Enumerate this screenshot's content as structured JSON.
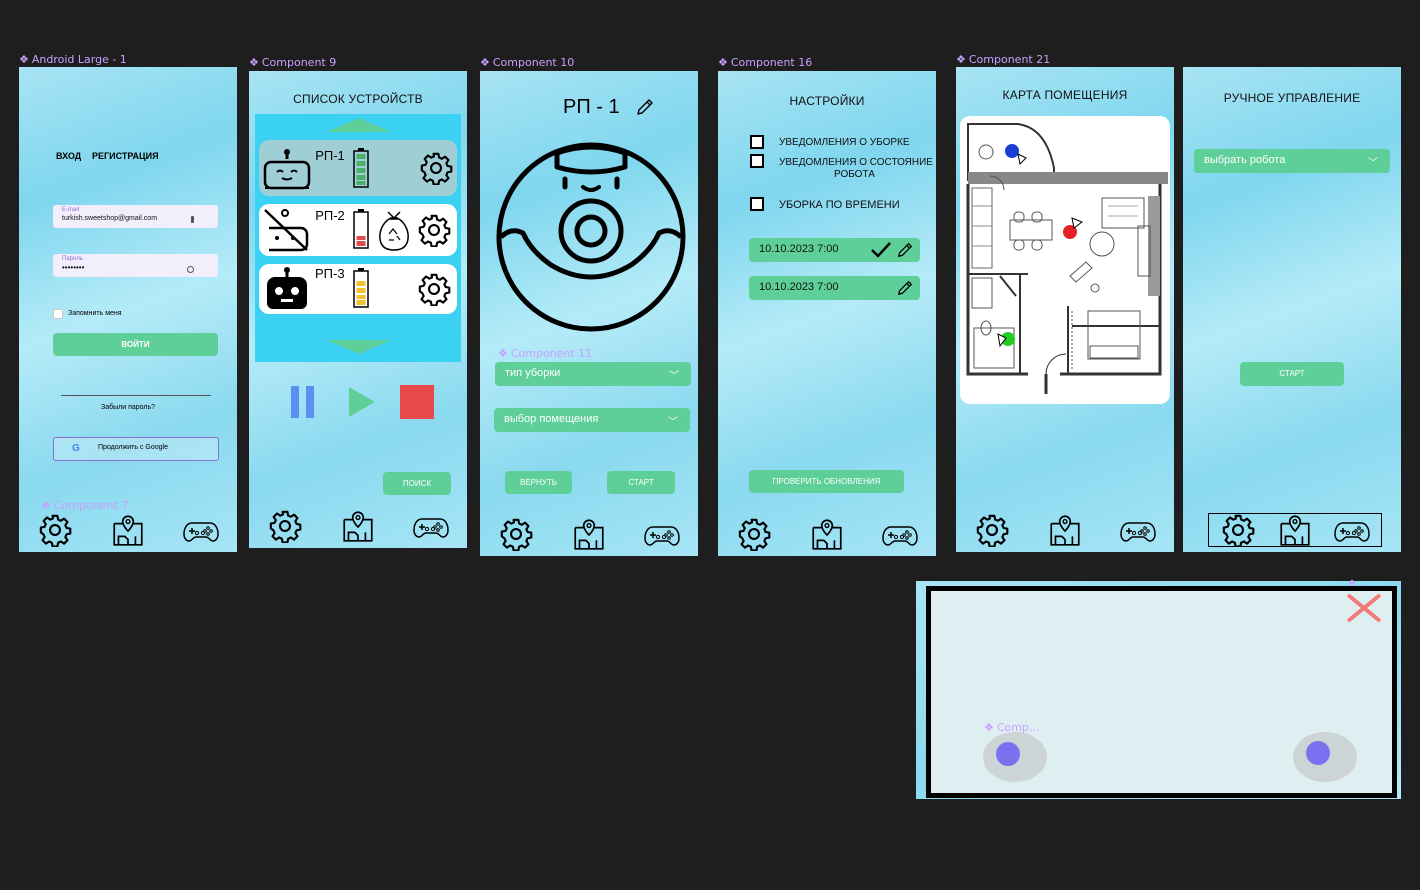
{
  "frames": {
    "login": {
      "label": "Android Large - 1"
    },
    "devices": {
      "label": "Component 9"
    },
    "robot": {
      "label": "Component 10"
    },
    "settings": {
      "label": "Component 16"
    },
    "map": {
      "label": "Component 21"
    }
  },
  "sublabels": {
    "c7": "Component 7",
    "c11": "Component 11",
    "comp": "Comp...",
    "dots": "..."
  },
  "login": {
    "tab_login": "ВХОД",
    "tab_register": "РЕГИСТРАЦИЯ",
    "email_label": "E-mail",
    "email_value": "turkish.sweetshop@gmail.com",
    "password_label": "Пароль",
    "password_value": "••••••••",
    "remember": "Запомнить меня",
    "submit": "ВОЙТИ",
    "forgot": "Забыли пароль?",
    "google": "Продолжить с Google"
  },
  "devices": {
    "title": "СПИСОК УСТРОЙСТВ",
    "items": [
      {
        "name": "РП-1"
      },
      {
        "name": "РП-2"
      },
      {
        "name": "РП-3"
      }
    ],
    "search": "ПОИСК"
  },
  "robot": {
    "title": "РП - 1",
    "cleaning_type": "тип уборки",
    "room_select": "выбор помещения",
    "back": "ВЕРНУТЬ",
    "start": "СТАРТ"
  },
  "settings": {
    "title": "НАСТРОЙКИ",
    "opt1": "УВЕДОМЛЕНИЯ О УБОРКЕ",
    "opt2a": "УВЕДОМЛЕНИЯ О СОСТОЯНИЕ",
    "opt2b": "РОБОТА",
    "opt3": "УБОРКА ПО ВРЕМЕНИ",
    "schedules": [
      "10.10.2023 7:00",
      "10.10.2023 7:00"
    ],
    "check_updates": "ПРОВЕРИТЬ ОБНОВЛЕНИЯ"
  },
  "map": {
    "title": "КАРТА ПОМЕЩЕНИЯ"
  },
  "manual": {
    "title": "РУЧНОЕ УПРАВЛЕНИЕ",
    "select_robot": "выбрать робота",
    "start": "СТАРТ"
  },
  "colors": {
    "accent_green": "#5fcf9a",
    "battery_green": "#4caf6a",
    "battery_red": "#e04b4b",
    "battery_yellow": "#f2c12e",
    "pause_blue": "#5b8ff0",
    "stop_red": "#e84a4a",
    "robot_red": "#e8202a",
    "robot_blue": "#1a3fd4",
    "robot_green": "#22cc22",
    "close_red": "#ef7b7b",
    "figma_purple": "#c9a0ff"
  },
  "icons": [
    "gear-icon",
    "map-pin-icon",
    "gamepad-icon",
    "robot-icon",
    "battery-icon",
    "trash-bag-icon",
    "pencil-icon",
    "check-icon",
    "chevron-down-icon",
    "google-icon",
    "pause-icon",
    "play-icon",
    "stop-icon",
    "close-icon",
    "eye-icon"
  ]
}
